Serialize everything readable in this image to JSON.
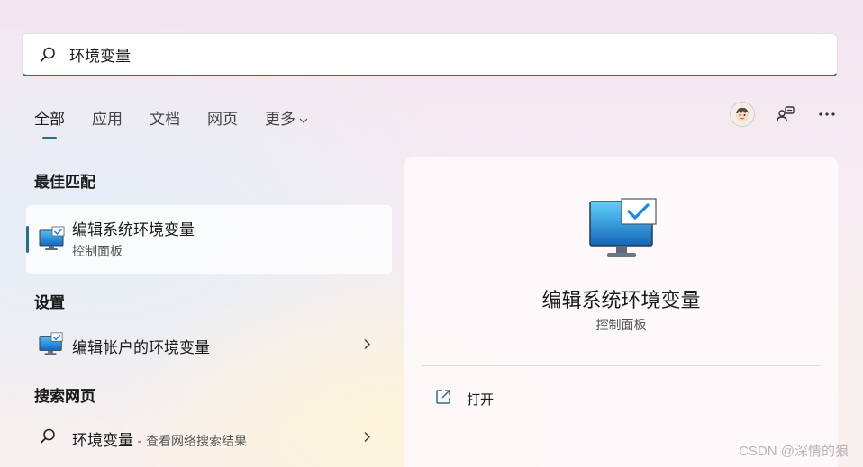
{
  "search": {
    "query": "环境变量",
    "icon": "search-icon"
  },
  "tabs": [
    {
      "label": "全部",
      "active": true
    },
    {
      "label": "应用"
    },
    {
      "label": "文档"
    },
    {
      "label": "网页"
    },
    {
      "label": "更多",
      "has_dropdown": true
    }
  ],
  "top_actions": {
    "avatar": "user-avatar",
    "share_icon": "account-switch-icon",
    "more_icon": "more-options-icon"
  },
  "best_match": {
    "section": "最佳匹配",
    "title": "编辑系统环境变量",
    "subtitle": "控制面板"
  },
  "settings": {
    "section": "设置",
    "item": "编辑帐户的环境变量"
  },
  "web": {
    "section": "搜索网页",
    "query": "环境变量",
    "suffix": " - 查看网络搜索结果"
  },
  "details": {
    "title": "编辑系统环境变量",
    "subtitle": "控制面板",
    "actions": [
      {
        "label": "打开",
        "icon": "open-external-icon"
      }
    ]
  },
  "watermark": "CSDN @深情的狼",
  "colors": {
    "accent": "#2b6d8d",
    "monitor_blue": "#1f8ad1"
  }
}
